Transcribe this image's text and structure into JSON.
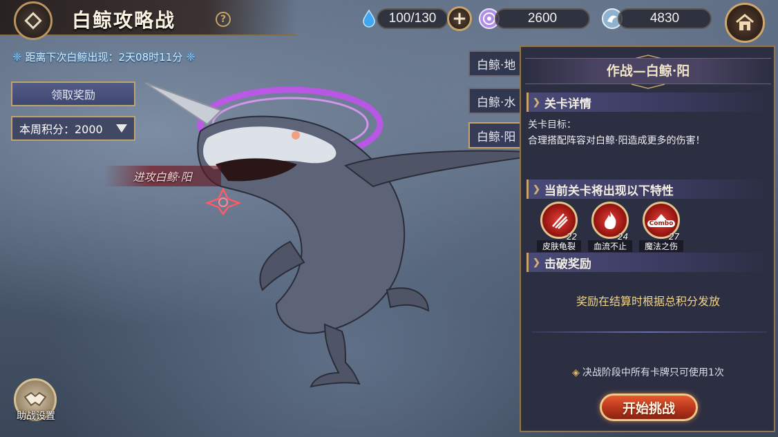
{
  "header": {
    "title": "白鲸攻略战",
    "help": "?"
  },
  "resources": {
    "stamina": "100/130",
    "currency_purple": "2600",
    "currency_blue": "4830"
  },
  "left": {
    "countdown": "距离下次白鲸出现：2天08时11分",
    "claim_button": "领取奖励",
    "week_score": "本周积分：2000",
    "attack_label": "进攻白鲸·阳",
    "assist_label": "助战设置"
  },
  "tabs": [
    {
      "label": "白鲸·地"
    },
    {
      "label": "白鲸·水"
    },
    {
      "label": "白鲸·阳"
    }
  ],
  "panel": {
    "title": "作战—白鲸·阳",
    "details_header": "关卡详情",
    "goal_label": "关卡目标：",
    "goal_text": "合理搭配阵容对白鲸·阳造成更多的伤害！",
    "traits_header": "当前关卡将出现以下特性",
    "traits": [
      {
        "name": "皮肤龟裂",
        "level": "22",
        "icon": "claw-slash-icon"
      },
      {
        "name": "血流不止",
        "level": "24",
        "icon": "flame-icon"
      },
      {
        "name": "魔法之伤",
        "level": "27",
        "icon": "combo-icon",
        "badge": "Combo"
      }
    ],
    "reward_header": "击破奖励",
    "reward_note": "奖励在结算时根据总积分发放",
    "rule_note": "决战阶段中所有卡牌只可使用1次",
    "start_button": "开始挑战"
  },
  "colors": {
    "accent_gold": "#c8a46a",
    "panel_bg": "#2c2e42",
    "start_red": "#c53a1e",
    "reward_yellow": "#f2d68a"
  }
}
